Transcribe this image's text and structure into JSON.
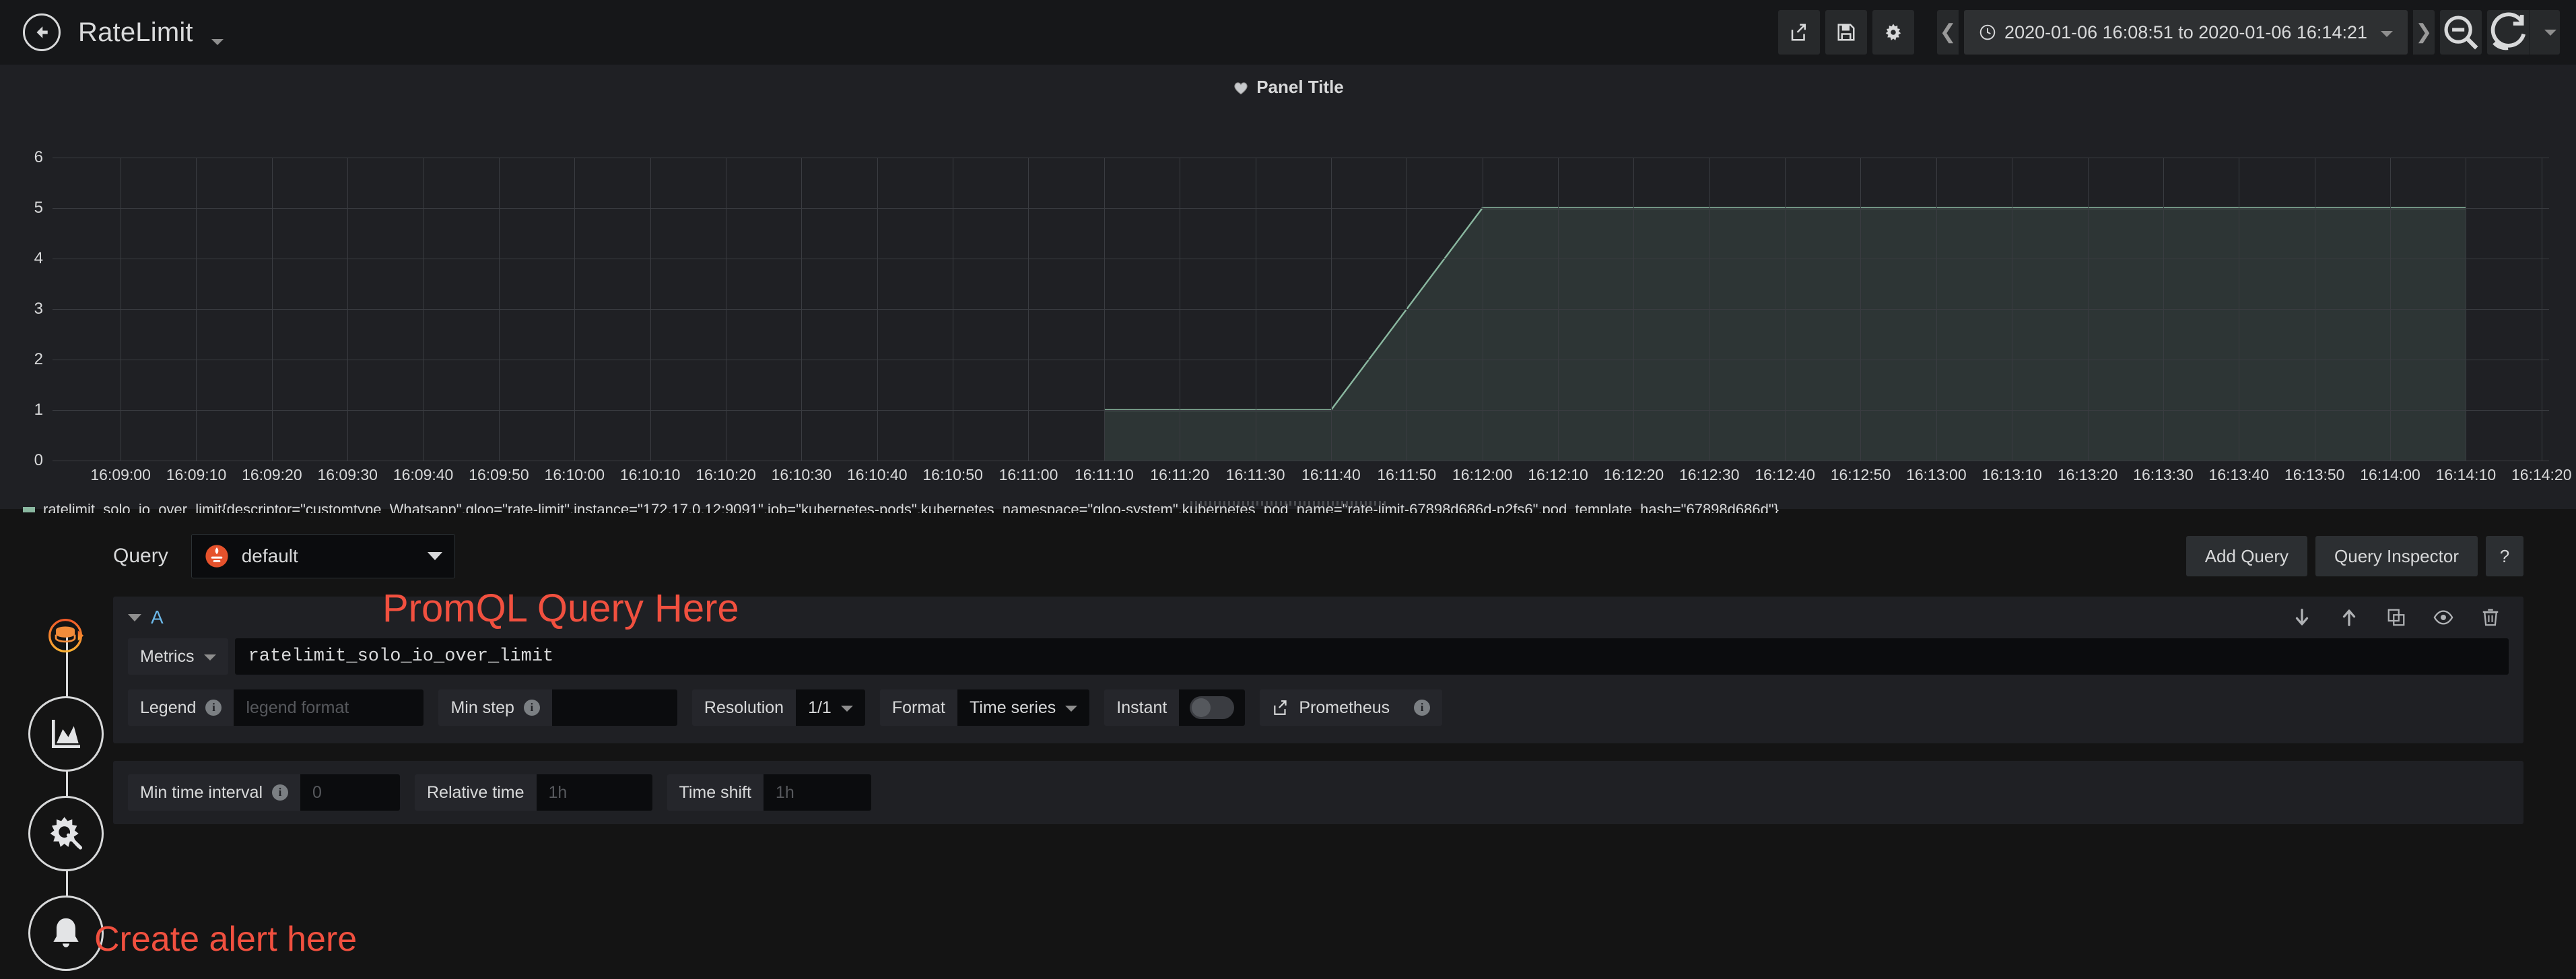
{
  "topnav": {
    "back_icon": "arrow-left-circle-icon",
    "dashboard_title": "RateLimit",
    "share_icon": "share-icon",
    "save_icon": "save-icon",
    "settings_icon": "gear-icon",
    "prev_icon": "chevron-left-icon",
    "next_icon": "chevron-right-icon",
    "clock_icon": "clock-icon",
    "time_range": "2020-01-06 16:08:51 to 2020-01-06 16:14:21",
    "zoom_out_icon": "zoom-out-icon",
    "refresh_icon": "refresh-icon",
    "refresh_caret_icon": "chevron-down-icon"
  },
  "panel": {
    "heart_icon": "heart-icon",
    "title": "Panel Title",
    "legend_series": "ratelimit_solo_io_over_limit{descriptor=\"customtype_Whatsapp\",gloo=\"rate-limit\",instance=\"172.17.0.12:9091\",job=\"kubernetes-pods\",kubernetes_namespace=\"gloo-system\",kubernetes_pod_name=\"rate-limit-67898d686d-p2fs6\",pod_template_hash=\"67898d686d\"}",
    "series_color": "#8ab8a0"
  },
  "chart_data": {
    "type": "line",
    "title": "Panel Title",
    "xlabel": "",
    "ylabel": "",
    "ylim": [
      0,
      6
    ],
    "yticks": [
      0,
      1,
      2,
      3,
      4,
      5,
      6
    ],
    "grid": true,
    "legend_position": "bottom",
    "x_start": "16:08:51",
    "x_end": "16:14:21",
    "xticks": [
      "16:09:00",
      "16:09:10",
      "16:09:20",
      "16:09:30",
      "16:09:40",
      "16:09:50",
      "16:10:00",
      "16:10:10",
      "16:10:20",
      "16:10:30",
      "16:10:40",
      "16:10:50",
      "16:11:00",
      "16:11:10",
      "16:11:20",
      "16:11:30",
      "16:11:40",
      "16:11:50",
      "16:12:00",
      "16:12:10",
      "16:12:20",
      "16:12:30",
      "16:12:40",
      "16:12:50",
      "16:13:00",
      "16:13:10",
      "16:13:20",
      "16:13:30",
      "16:13:40",
      "16:13:50",
      "16:14:00",
      "16:14:10",
      "16:14:20"
    ],
    "series": [
      {
        "name": "ratelimit_solo_io_over_limit{descriptor=\"customtype_Whatsapp\",gloo=\"rate-limit\",instance=\"172.17.0.12:9091\",job=\"kubernetes-pods\",kubernetes_namespace=\"gloo-system\",kubernetes_pod_name=\"rate-limit-67898d686d-p2fs6\",pod_template_hash=\"67898d686d\"}",
        "color": "#8ab8a0",
        "fill": true,
        "points": [
          {
            "x": "16:11:10",
            "y": 1
          },
          {
            "x": "16:11:40",
            "y": 1
          },
          {
            "x": "16:12:00",
            "y": 5
          },
          {
            "x": "16:14:10",
            "y": 5
          }
        ]
      }
    ]
  },
  "editor": {
    "query_label": "Query",
    "datasource": {
      "icon": "prometheus-icon",
      "value": "default",
      "caret_icon": "chevron-down-icon"
    },
    "add_query_label": "Add Query",
    "query_inspector_label": "Query Inspector",
    "help_label": "?",
    "query_row": {
      "collapse_icon": "chevron-down-icon",
      "ref_id": "A",
      "annotation": "PromQL Query Here",
      "icons": [
        "arrow-down-icon",
        "arrow-up-icon",
        "duplicate-icon",
        "eye-icon",
        "trash-icon"
      ],
      "metrics_label": "Metrics",
      "metrics_caret_icon": "chevron-down-icon",
      "expression": "ratelimit_solo_io_over_limit",
      "legend_label": "Legend",
      "legend_info_icon": "info-icon",
      "legend_placeholder": "legend format",
      "legend_value": "",
      "min_step_label": "Min step",
      "min_step_info_icon": "info-icon",
      "min_step_value": "",
      "min_step_placeholder": "",
      "resolution_label": "Resolution",
      "resolution_value": "1/1",
      "resolution_caret_icon": "chevron-down-icon",
      "format_label": "Format",
      "format_value": "Time series",
      "format_caret_icon": "chevron-down-icon",
      "instant_label": "Instant",
      "instant_toggle": "off",
      "prometheus_link_icon": "external-link-icon",
      "prometheus_link_label": "Prometheus",
      "prometheus_info_icon": "info-icon"
    },
    "bottom_options": {
      "min_time_interval_label": "Min time interval",
      "min_time_interval_info_icon": "info-icon",
      "min_time_interval_placeholder": "0",
      "min_time_interval_value": "",
      "relative_time_label": "Relative time",
      "relative_time_placeholder": "1h",
      "relative_time_value": "",
      "time_shift_label": "Time shift",
      "time_shift_placeholder": "1h",
      "time_shift_value": ""
    }
  },
  "sidebar": {
    "items": [
      {
        "name": "queries-tab",
        "icon": "database-icon",
        "active": true
      },
      {
        "name": "visualization-tab",
        "icon": "area-chart-icon",
        "active": false
      },
      {
        "name": "general-tab",
        "icon": "gear-wrench-icon",
        "active": false
      },
      {
        "name": "alert-tab",
        "icon": "bell-icon",
        "active": false
      }
    ],
    "alert_annotation": "Create alert here"
  },
  "colors": {
    "annotation_red": "#f1503f",
    "series_green": "#8ab8a0",
    "ref_blue": "#6cb8e8",
    "prometheus_orange": "#e6522c"
  }
}
